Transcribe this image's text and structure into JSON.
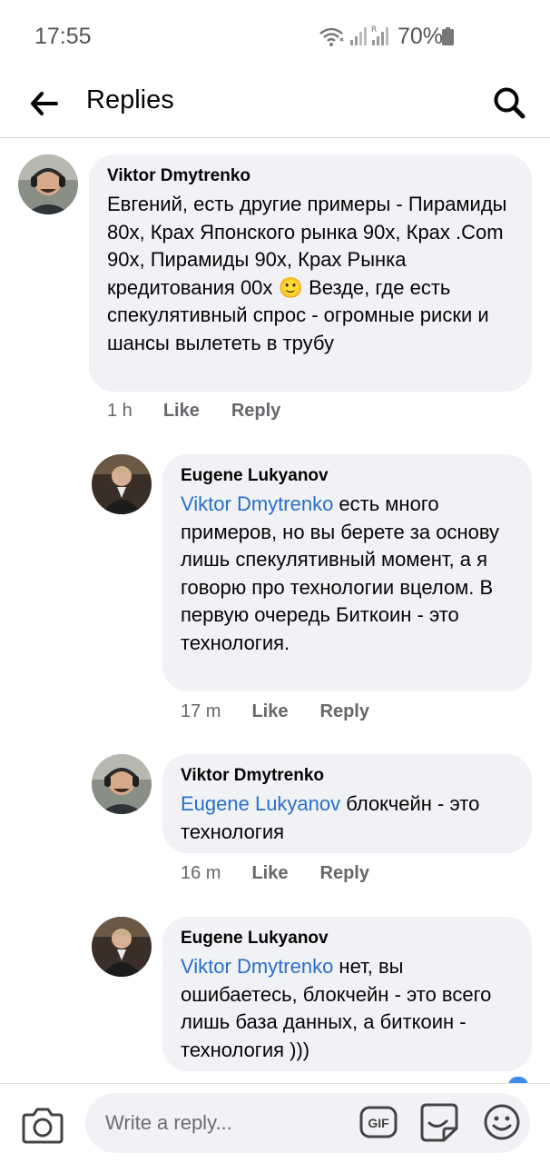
{
  "status_bar": {
    "time": "17:55",
    "battery": "70%",
    "icons": [
      "wifi-icon",
      "signal-icon",
      "signal-r-icon",
      "battery-icon"
    ]
  },
  "header": {
    "title": "Replies",
    "back_icon": "arrow-left-icon",
    "search_icon": "search-icon"
  },
  "comments": [
    {
      "author": "Viktor Dmytrenko",
      "mention": "",
      "text": "Евгений, есть другие примеры - Пирамиды 80х, Крах Японского рынка 90х, Крах .Com 90х, Пирамиды 90х, Крах Рынка кредитования 00х",
      "text_after_emoji": " Везде, где есть спекулятивный спрос - огромные риски и шансы вылететь в трубу",
      "emoji": "🙂",
      "time": "1 h",
      "like": "Like",
      "reply": "Reply"
    },
    {
      "author": "Eugene Lukyanov",
      "mention": "Viktor Dmytrenko",
      "text": " есть много примеров, но вы берете за основу лишь спекулятивный момент, а я говорю про технологии вцелом. В первую очередь Биткоин - это технология.",
      "time": "17 m",
      "like": "Like",
      "reply": "Reply"
    },
    {
      "author": "Viktor Dmytrenko",
      "mention": "Eugene Lukyanov",
      "text": " блокчейн - это технология",
      "time": "16 m",
      "like": "Like",
      "reply": "Reply"
    },
    {
      "author": "Eugene Lukyanov",
      "mention": "Viktor Dmytrenko",
      "text": " нет, вы ошибаетесь, блокчейн - это всего лишь база данных, а биткоин - технология )))"
    }
  ],
  "composer": {
    "placeholder": "Write a reply...",
    "camera_icon": "camera-icon",
    "gif_icon": "gif-icon",
    "sticker_icon": "sticker-icon",
    "emoji_icon": "emoji-icon"
  }
}
